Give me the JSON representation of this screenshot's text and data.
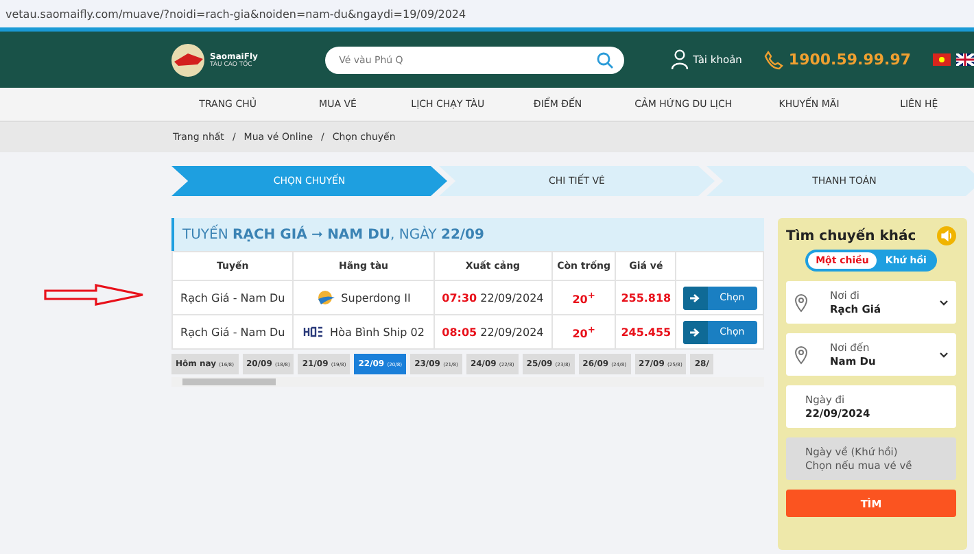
{
  "address_bar": {
    "url": "vetau.saomaifly.com/muave/?noidi=rach-gia&noiden=nam-du&ngaydi=19/09/2024"
  },
  "header": {
    "logo_name": "SaomaiFly",
    "logo_tagline": "TÀU CAO TỐC",
    "search": {
      "placeholder": "Vé vàu Phú Q"
    },
    "account": "Tài khoản",
    "hotline": "1900.59.99.97"
  },
  "nav": [
    {
      "label": "TRANG CHỦ"
    },
    {
      "label": "MUA VÉ"
    },
    {
      "label": "LỊCH CHẠY TÀU"
    },
    {
      "label": "ĐIỂM ĐẾN"
    },
    {
      "label": "CẢM HỨNG DU LỊCH"
    },
    {
      "label": "KHUYẾN MÃI"
    },
    {
      "label": "LIÊN HỆ"
    }
  ],
  "breadcrumb": {
    "items": [
      "Trang nhất",
      "Mua vé Online",
      "Chọn chuyến"
    ],
    "separator": "/"
  },
  "steps": [
    {
      "label": "CHỌN CHUYẾN",
      "selected": true
    },
    {
      "label": "CHI TIẾT VÉ",
      "selected": false
    },
    {
      "label": "THANH TOÁN",
      "selected": false
    }
  ],
  "route_panel": {
    "title": "TUYẾN **RẠCH GIÁ** ➞ **NAM DU**, NGÀY **22/09**",
    "columns": [
      "Tuyến",
      "Hãng tàu",
      "Xuất cảng",
      "Còn trống",
      "Giá vé"
    ],
    "rows": [
      {
        "route": "Rạch Giá - Nam Du",
        "kind": "superdong",
        "carrier": "Superdong II",
        "time": "07:30",
        "date": "22/09/2024",
        "seats": "20$^{+}$",
        "price": "255.818",
        "button": "Chọn"
      },
      {
        "route": "Rạch Giá - Nam Du",
        "kind": "hbs",
        "carrier": "Hòa Bình Ship 02",
        "time": "08:05",
        "date": "22/09/2024",
        "seats": "20$^{+}$",
        "price": "245.455",
        "button": "Chọn"
      }
    ],
    "date_tabs": [
      {
        "label": "Hôm nay",
        "lunar": "(16/8)",
        "selected": false
      },
      {
        "label": "20/09",
        "lunar": "(18/8)",
        "selected": false
      },
      {
        "label": "21/09",
        "lunar": "(19/8)",
        "selected": false
      },
      {
        "label": "22/09",
        "lunar": "(20/8)",
        "selected": true
      },
      {
        "label": "23/09",
        "lunar": "(21/8)",
        "selected": false
      },
      {
        "label": "24/09",
        "lunar": "(22/8)",
        "selected": false
      },
      {
        "label": "25/09",
        "lunar": "(23/8)",
        "selected": false
      },
      {
        "label": "26/09",
        "lunar": "(24/8)",
        "selected": false
      },
      {
        "label": "27/09",
        "lunar": "(25/8)",
        "selected": false
      },
      {
        "label": "28/",
        "selected": false
      }
    ]
  },
  "search_panel": {
    "title": "Tìm chuyến khác",
    "trip_types": [
      {
        "label": "Một chiều",
        "selected": true
      },
      {
        "label": "Khứ hồi",
        "selected": false
      }
    ],
    "fields": [
      {
        "kind": "select",
        "label": "Nơi đi",
        "value": "Rạch Giá",
        "disabled": false
      },
      {
        "kind": "select",
        "label": "Nơi đến",
        "value": "Nam Du",
        "disabled": false
      },
      {
        "kind": "date",
        "label": "Ngày đi",
        "value": "22/09/2024",
        "disabled": false
      },
      {
        "kind": "date",
        "label": "Ngày về (Khứ hồi)",
        "value": "Chọn nếu mua vé về",
        "disabled": true
      }
    ],
    "button": "TÌM"
  }
}
